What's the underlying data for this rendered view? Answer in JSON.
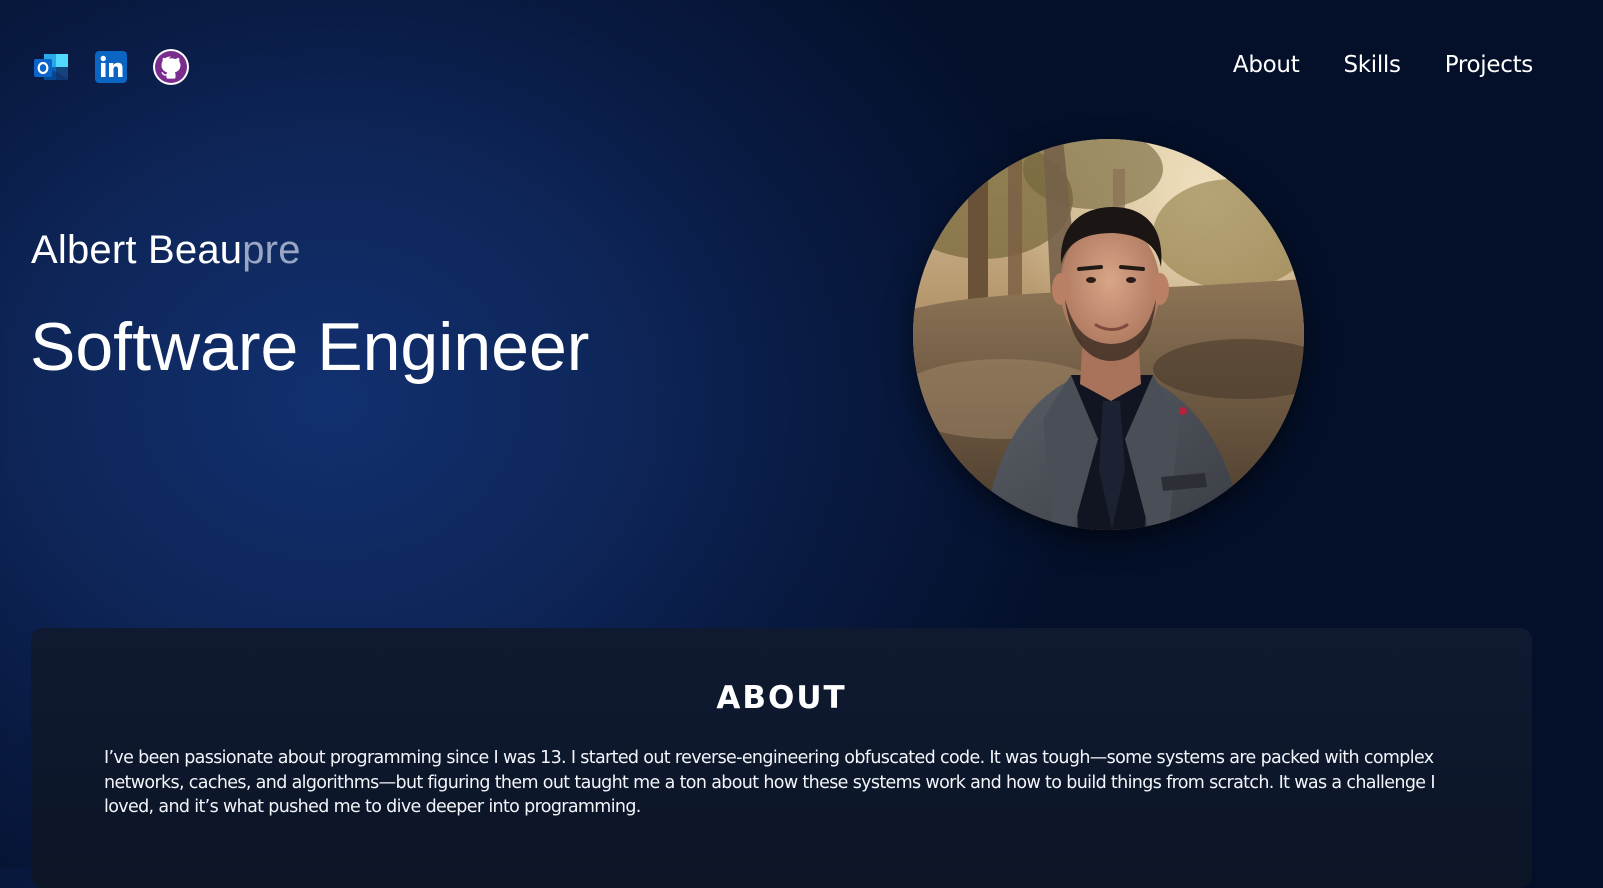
{
  "social": [
    {
      "name": "outlook-icon",
      "label": "Outlook",
      "color": "#0a64c9"
    },
    {
      "name": "linkedin-icon",
      "label": "LinkedIn",
      "color": "#0a66c2"
    },
    {
      "name": "github-icon",
      "label": "GitHub",
      "color": "#7b2d8e"
    }
  ],
  "nav": {
    "about": "About",
    "skills": "Skills",
    "projects": "Projects"
  },
  "hero": {
    "name_solid": "Albert Beau",
    "name_faded": "pre",
    "role": "Software Engineer",
    "photo_icon": "portrait-photo"
  },
  "about": {
    "title": "ABOUT",
    "text": "I’ve been passionate about programming since I was 13. I started out reverse-engineering obfuscated code. It was tough—some systems are packed with complex networks, caches, and algorithms—but figuring them out taught me a ton about how these systems work and how to build things from scratch. It was a challenge I loved, and it’s what pushed me to dive deeper into programming."
  },
  "colors": {
    "background_dark": "#04102a",
    "background_glow": "#123070",
    "card": "#0e1729",
    "text": "#ffffff",
    "name_faded": "#9aa7c4"
  }
}
